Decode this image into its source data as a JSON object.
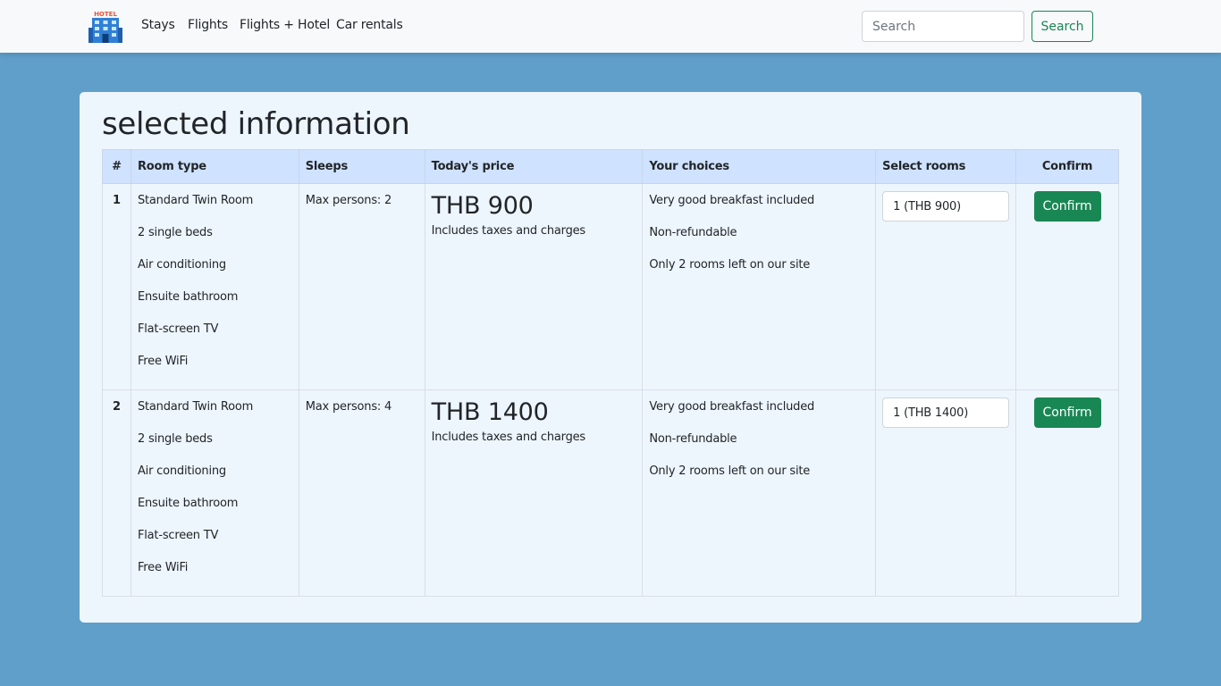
{
  "nav": {
    "logo_text": "HOTEL",
    "links": [
      "Stays",
      "Flights",
      "Flights + Hotel",
      "Car rentals"
    ],
    "search_placeholder": "Search",
    "search_button": "Search"
  },
  "colors": {
    "page_background": "#5f9fca",
    "card_background": "#eef6fd",
    "table_header": "#cfe2ff",
    "success": "#198754"
  },
  "main": {
    "title": "selected information",
    "table": {
      "headers": [
        "#",
        "Room type",
        "Sleeps",
        "Today's price",
        "Your choices",
        "Select rooms",
        "Confirm"
      ],
      "rows": [
        {
          "num": "1",
          "room_type": [
            "Standard Twin Room",
            "2 single beds",
            "Air conditioning",
            "Ensuite bathroom",
            "Flat-screen TV",
            "Free WiFi"
          ],
          "sleeps": "Max persons: 2",
          "price": "THB 900",
          "price_note": "Includes taxes and charges",
          "choices": [
            "Very good breakfast included",
            "Non-refundable",
            "Only 2 rooms left on our site"
          ],
          "select_value": "1 (THB 900)",
          "confirm_label": "Confirm"
        },
        {
          "num": "2",
          "room_type": [
            "Standard Twin Room",
            "2 single beds",
            "Air conditioning",
            "Ensuite bathroom",
            "Flat-screen TV",
            "Free WiFi"
          ],
          "sleeps": "Max persons: 4",
          "price": "THB 1400",
          "price_note": "Includes taxes and charges",
          "choices": [
            "Very good breakfast included",
            "Non-refundable",
            "Only 2 rooms left on our site"
          ],
          "select_value": "1 (THB 1400)",
          "confirm_label": "Confirm"
        }
      ]
    }
  }
}
